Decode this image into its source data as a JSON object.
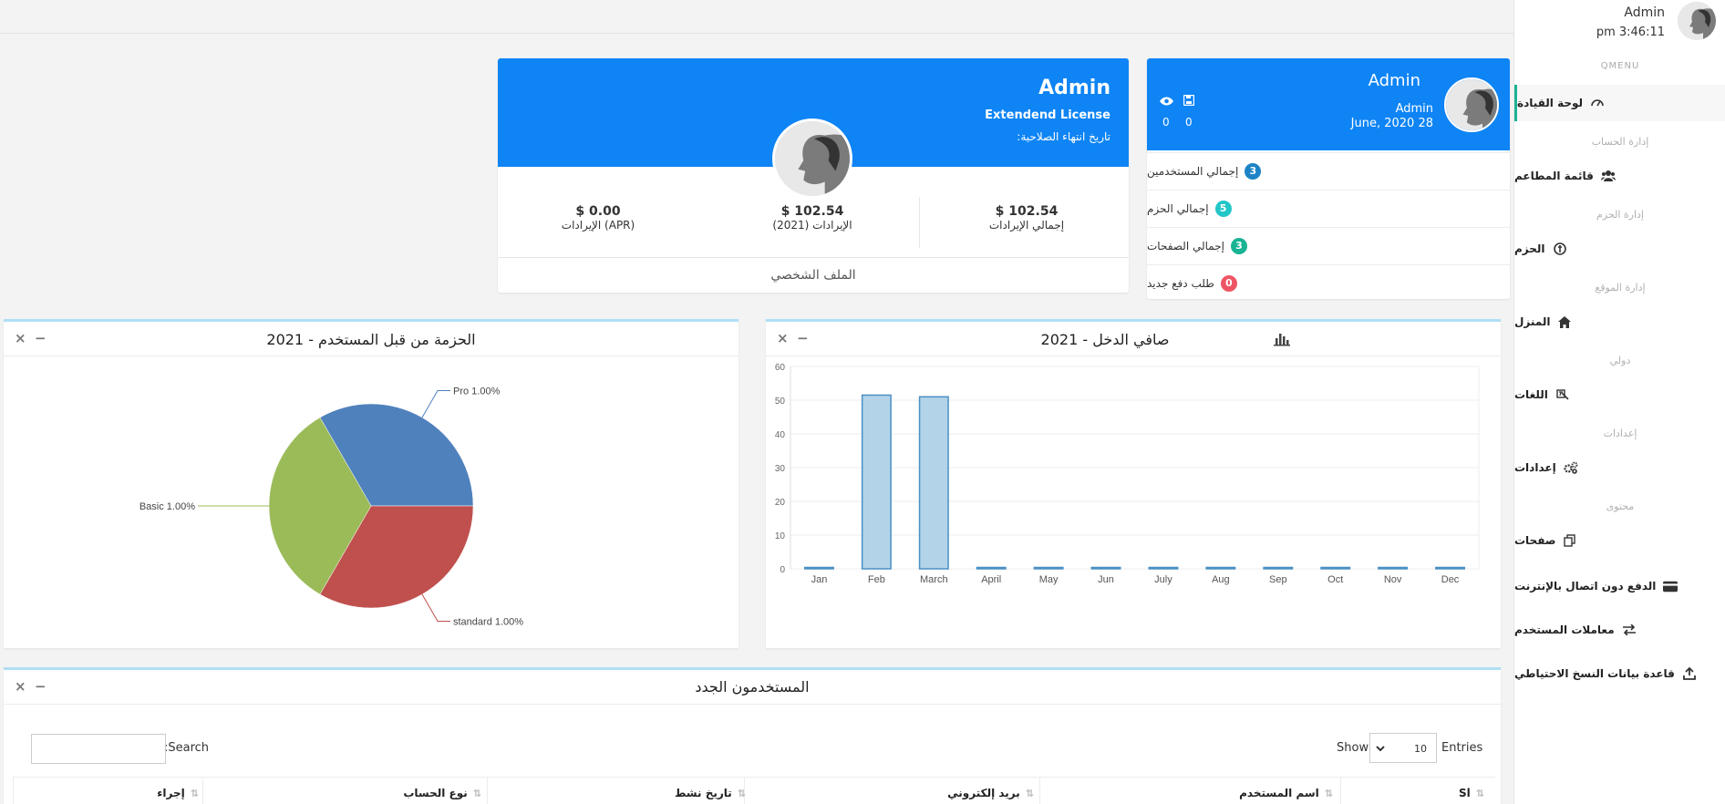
{
  "header": {
    "user_name": "Admin",
    "time": "pm 3:46:11"
  },
  "sidebar": {
    "qmenu": "QMENU",
    "items": [
      {
        "label": "لوحة القيادة",
        "icon": "dashboard-gauge-icon",
        "active": true
      },
      {
        "section": "إدارة الحساب",
        "label": "قائمة المطاعم",
        "icon": "users-icon"
      },
      {
        "section": "إدارة الحزم",
        "label": "الحزم",
        "icon": "packages-icon"
      },
      {
        "section": "إدارة الموقع",
        "label": "المنزل",
        "icon": "home-icon"
      },
      {
        "section": "دولي",
        "label": "اللغات",
        "icon": "language-icon"
      },
      {
        "section": "إعدادات",
        "label": "إعدادات",
        "icon": "gears-icon"
      },
      {
        "section": "محتوى",
        "label": "صفحات",
        "icon": "pages-icon"
      },
      {
        "label": "الدفع دون اتصال بالإنترنت",
        "icon": "credit-card-icon"
      },
      {
        "label": "معاملات المستخدم",
        "icon": "exchange-icon"
      },
      {
        "label": "قاعدة بيانات النسخ الاحتياطي",
        "icon": "upload-icon"
      }
    ]
  },
  "user_card": {
    "name": "Admin",
    "role": "Admin",
    "date": "June, 2020 28",
    "views": "0",
    "saves": "0",
    "stats": [
      {
        "label": "إجمالي المستخدمين",
        "count": "3",
        "color": "#1c84c6"
      },
      {
        "label": "إجمالي الحزم",
        "count": "5",
        "color": "#23c6c8"
      },
      {
        "label": "إجمالي الصفحات",
        "count": "3",
        "color": "#1ab394"
      },
      {
        "label": "طلب دفع جديد",
        "count": "0",
        "color": "#ed5565"
      }
    ]
  },
  "profile_card": {
    "name": "Admin",
    "license": "Extendend License",
    "expiry_label": "تاريخ انتهاء الصلاحية:",
    "revenues": [
      {
        "amount": "$ 102.54",
        "label": "إجمالي الإيرادات"
      },
      {
        "amount": "$ 102.54",
        "label": "الإيرادات (2021)"
      },
      {
        "amount": "$ 0.00",
        "label": "الإيرادات (APR)"
      }
    ],
    "profile_link": "الملف الشخصي"
  },
  "income_widget": {
    "title": "صافي الدخل - 2021",
    "close": "×",
    "minimize": "−"
  },
  "package_widget": {
    "title": "الحزمة من قبل المستخدم - 2021",
    "close": "×",
    "minimize": "−"
  },
  "chart_data": [
    {
      "type": "bar",
      "title": "صافي الدخل - 2021",
      "categories": [
        "Jan",
        "Feb",
        "March",
        "April",
        "May",
        "Jun",
        "July",
        "Aug",
        "Sep",
        "Oct",
        "Nov",
        "Dec"
      ],
      "values": [
        0,
        51.5,
        51,
        0,
        0,
        0,
        0,
        0,
        0,
        0,
        0,
        0
      ],
      "yticks": [
        "0",
        "10",
        "20",
        "30",
        "40",
        "50",
        "60"
      ],
      "ylim": [
        0,
        60
      ],
      "grid": true,
      "colors": {
        "fill": "#b3d4e8",
        "stroke": "#4a90c4"
      }
    },
    {
      "type": "pie",
      "title": "الحزمة من قبل المستخدم - 2021",
      "slices": [
        {
          "label": "Pro 1.00%",
          "value": 1,
          "color": "#4f81bd"
        },
        {
          "label": "standard 1.00%",
          "value": 1,
          "color": "#c0504d"
        },
        {
          "label": "Basic 1.00%",
          "value": 1,
          "color": "#9bbb59"
        }
      ]
    }
  ],
  "new_users": {
    "title": "المستخدمون الجدد",
    "close": "×",
    "minimize": "−",
    "show_label": "Show",
    "entries_value": "10",
    "entries_label": "Entries",
    "search_label": ":Search",
    "columns": [
      "Sl",
      "اسم المستخدم",
      "بريد إلكتروني",
      "تاريخ نشط",
      "نوع الحساب",
      "إجراء"
    ]
  }
}
